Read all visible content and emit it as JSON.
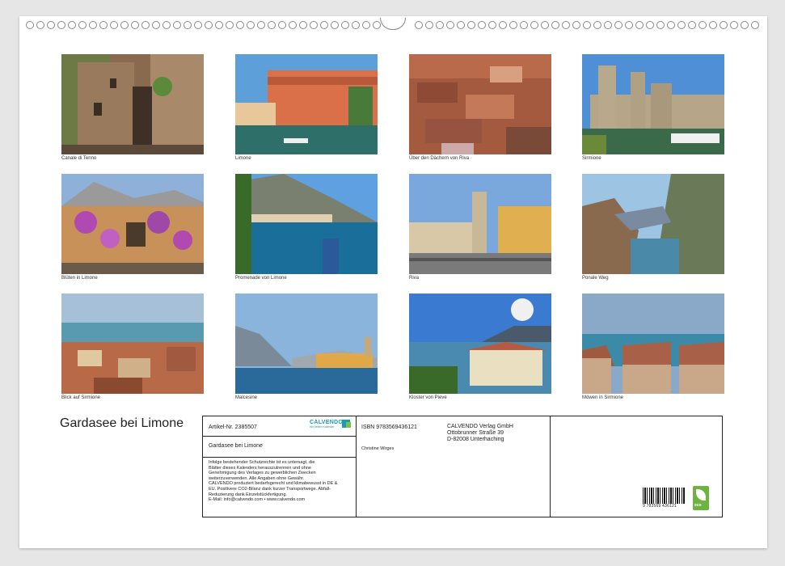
{
  "calendar": {
    "title": "Gardasee bei Limone",
    "photos": [
      {
        "caption": "Canale di Tenno",
        "icon": "photo-stone-alley"
      },
      {
        "caption": "Limone",
        "icon": "photo-harbour-houses"
      },
      {
        "caption": "Über den Dächern von Riva",
        "icon": "photo-rooftops"
      },
      {
        "caption": "Sirmione",
        "icon": "photo-castle"
      },
      {
        "caption": "Blüten in Limone",
        "icon": "photo-flowers"
      },
      {
        "caption": "Promenade von Limone",
        "icon": "photo-lake-mountain"
      },
      {
        "caption": "Riva",
        "icon": "photo-clock-tower"
      },
      {
        "caption": "Ponale Weg",
        "icon": "photo-cliffs"
      },
      {
        "caption": "Blick auf Sirmione",
        "icon": "photo-town-view"
      },
      {
        "caption": "Malcesine",
        "icon": "photo-lakeside-town"
      },
      {
        "caption": "Kloster von Pieve",
        "icon": "photo-monastery"
      },
      {
        "caption": "Möwen in Sirmione",
        "icon": "photo-seagulls"
      }
    ]
  },
  "info": {
    "article": "Artikel-Nr. 2385507",
    "logo_name": "CALVENDO",
    "logo_sub": "Wir lieben Kalender",
    "product_title": "Gardasee bei Limone",
    "legal_text": [
      "Infolge bestehender Schutzrechte ist es untersagt, die",
      "Blätter dieses Kalenders herauszutrennen und ohne",
      "Genehmigung des Verlages zu gewerblichen Zwecken",
      "weiterzuverwenden. Alle Angaben ohne Gewähr.",
      "CALVENDO produziert bedarfsgerecht und klimabewusst in DE &",
      "EU. Positivere CO2-Bilanz dank kurzer Transportwege. Abfall-",
      "Reduzierung dank Einzelstückfertigung.",
      "E-Mail: info@calvendo.com • www.calvendo.com"
    ],
    "isbn": "ISBN 9783569436121",
    "author": "Christine Wirges",
    "publisher": [
      "CALVENDO Verlag GmbH",
      "Ottobrunner Straße 39",
      "D-82008 Unterhaching"
    ],
    "barcode_number": "9 783569 436121",
    "eco_label": "eco"
  },
  "colors": {
    "brand": "#1a9bb5",
    "eco_green": "#6cb33f"
  }
}
